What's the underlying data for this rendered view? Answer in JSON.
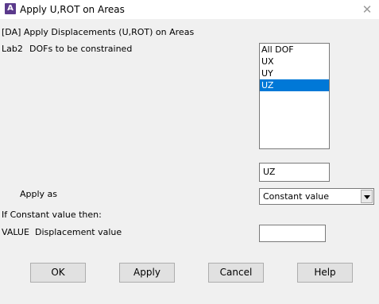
{
  "window": {
    "title": "Apply U,ROT on Areas",
    "icon": "ansys-app-icon",
    "close_glyph": "✕"
  },
  "heading": "[DA]  Apply Displacements (U,ROT) on Areas",
  "lab2": {
    "key": "Lab2",
    "label": "DOFs to be constrained",
    "options": [
      "All DOF",
      "UX",
      "UY",
      "UZ"
    ],
    "selected": "UZ",
    "selected_value_field": "UZ"
  },
  "apply_as": {
    "label": "Apply as",
    "value": "Constant value"
  },
  "constant_note": "If Constant value then:",
  "value_field": {
    "key": "VALUE",
    "label": "Displacement value",
    "value": ""
  },
  "buttons": {
    "ok": "OK",
    "apply": "Apply",
    "cancel": "Cancel",
    "help": "Help"
  },
  "colors": {
    "selection": "#0078d7",
    "background": "#f0f0f0",
    "title_bg": "#ffffff"
  }
}
